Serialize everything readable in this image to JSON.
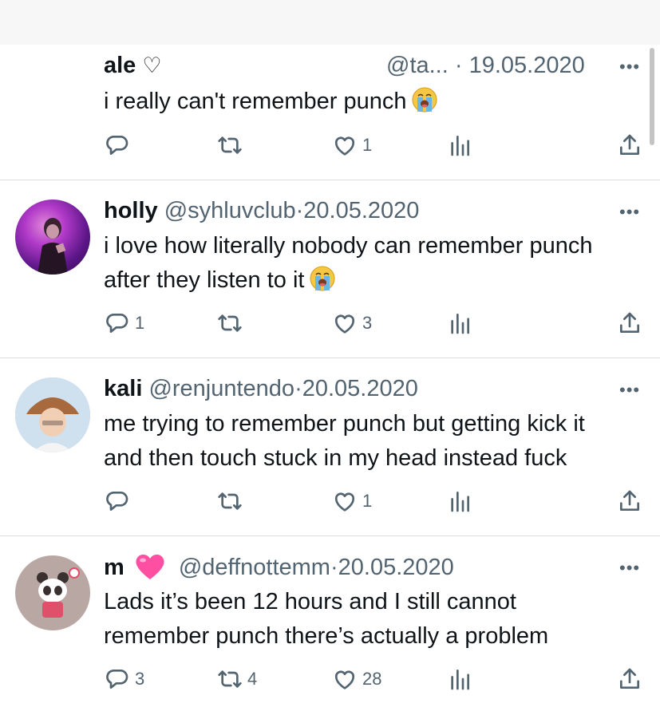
{
  "tweets": [
    {
      "name": "ale",
      "name_suffix": "♡",
      "handle": "@ta...",
      "sep": "·",
      "date": "19.05.2020",
      "text": "i really can't remember punch",
      "emoji": "loudly-crying-face",
      "replies": "",
      "retweets": "",
      "likes": "1"
    },
    {
      "name": "holly",
      "handle": "@syhluvclub",
      "sep": "·",
      "date": "20.05.2020",
      "text_lines": [
        "i love how literally nobody can remember punch",
        "after they listen to it"
      ],
      "emoji": "loudly-crying-face",
      "replies": "1",
      "retweets": "",
      "likes": "3"
    },
    {
      "name": "kali",
      "handle": "@renjuntendo",
      "sep": "·",
      "date": "20.05.2020",
      "text_lines": [
        "me trying to remember punch but getting kick it",
        "and then touch stuck in my head instead fuck"
      ],
      "replies": "",
      "retweets": "",
      "likes": "1"
    },
    {
      "name": "m",
      "name_emoji": "pink-heart",
      "handle": "@deffnottemm",
      "sep": "·",
      "date": "20.05.2020",
      "text_lines": [
        "Lads it’s been 12 hours and I still cannot",
        "remember punch there’s actually a problem"
      ],
      "replies": "3",
      "retweets": "4",
      "likes": "28"
    }
  ],
  "icons": {
    "reply": "speech-bubble-icon",
    "retweet": "retweet-arrows-icon",
    "like": "heart-outline-icon",
    "views": "bar-chart-icon",
    "share": "share-upload-icon",
    "more": "ellipsis-icon"
  },
  "colors": {
    "text": "#0f1419",
    "muted": "#536471",
    "divider": "#dcdcdc",
    "pink_heart": "#ff4fa3"
  }
}
